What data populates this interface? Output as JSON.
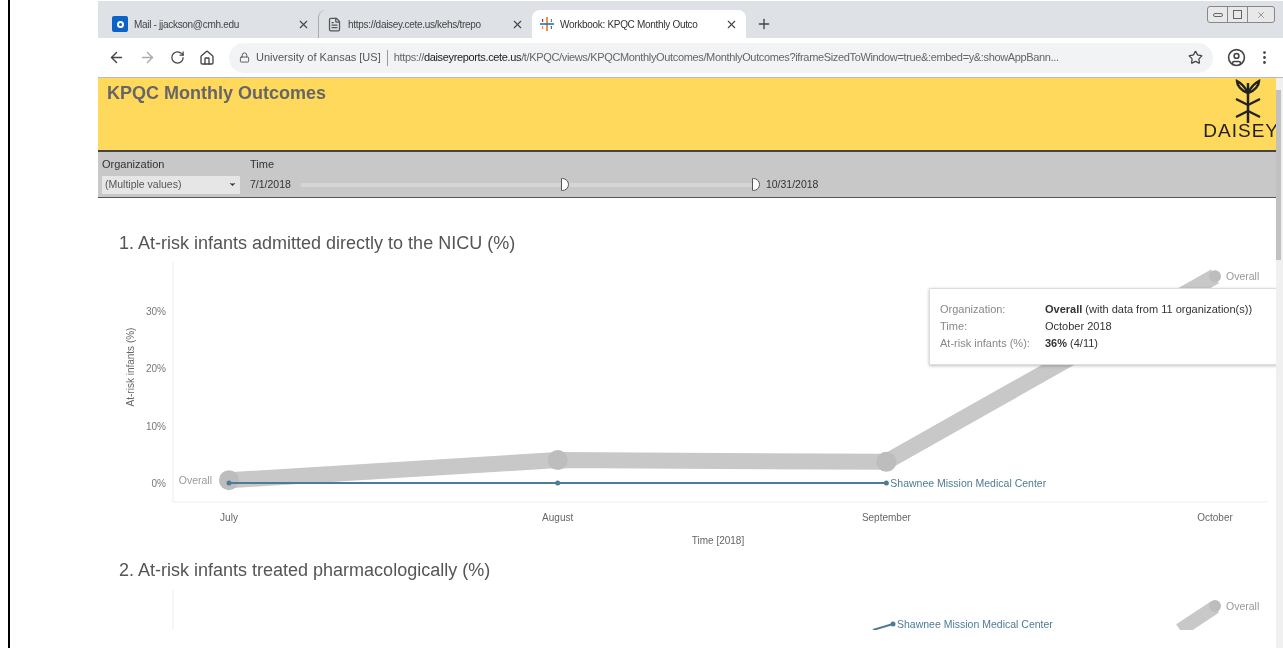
{
  "browser": {
    "tabs": [
      {
        "label": "Mail - jjackson@cmh.edu",
        "kind": "mail",
        "selected": false
      },
      {
        "label": "https://daisey.cete.us/kehs/trepo",
        "kind": "page",
        "selected": false
      },
      {
        "label": "Workbook: KPQC Monthly Outco",
        "kind": "workbook",
        "selected": true
      }
    ],
    "address": {
      "site": "University of Kansas [US]",
      "url_start": "https://",
      "url_domain": "daiseyreports.cete.us",
      "url_rest": "/t/KPQC/views/KPQCMonthlyOutcomes/MonthlyOutcomes?iframeSizedToWindow=true&:embed=y&:showAppBann..."
    }
  },
  "header": {
    "title": "KPQC Monthly Outcomes",
    "logo_text": "DAISEY"
  },
  "filters": {
    "organization": {
      "label": "Organization",
      "value": "(Multiple values)"
    },
    "time": {
      "label": "Time",
      "start": "7/1/2018",
      "end": "10/31/2018",
      "handles": [
        {
          "level": 0.58
        },
        {
          "level": 1.0
        }
      ]
    }
  },
  "charts": [
    {
      "title": "1. At-risk infants admitted directly to the NICU (%)",
      "chart_data": {
        "type": "line",
        "xlabel": "Time [2018]",
        "ylabel": "At-risk infants (%)",
        "categories": [
          "July",
          "August",
          "September",
          "October"
        ],
        "series": [
          {
            "name": "Overall",
            "color": "#c8c8c8",
            "marker": true,
            "values": [
              0.5,
              4,
              3.7,
              36
            ]
          },
          {
            "name": "Shawnee Mission Medical Center",
            "color": "#4e7b96",
            "marker": true,
            "values": [
              0,
              0,
              0,
              null
            ]
          }
        ],
        "ylim": [
          -3.3,
          38.5
        ],
        "yticks": [
          {
            "value": 0,
            "label": "0%"
          },
          {
            "value": 10,
            "label": "10%"
          },
          {
            "value": 20,
            "label": "20%"
          },
          {
            "value": 30,
            "label": "30%"
          }
        ]
      },
      "line_labels": [
        {
          "text": "Overall",
          "kind": "start"
        }
      ],
      "tooltip": {
        "rows": [
          {
            "label": "Organization:",
            "value": "**Overall** (with data from 11 organization(s))"
          },
          {
            "label": "Time:",
            "value": "October 2018"
          },
          {
            "label": "At-risk infants (%):",
            "value": "**36%** (4/11)"
          }
        ]
      }
    },
    {
      "title": "2. At-risk infants treated pharmacologically (%)",
      "line_labels": [
        {
          "text": "Shawnee Mission Medical Center",
          "kind": "org"
        },
        {
          "text": "Overall",
          "kind": "overall"
        }
      ]
    }
  ]
}
